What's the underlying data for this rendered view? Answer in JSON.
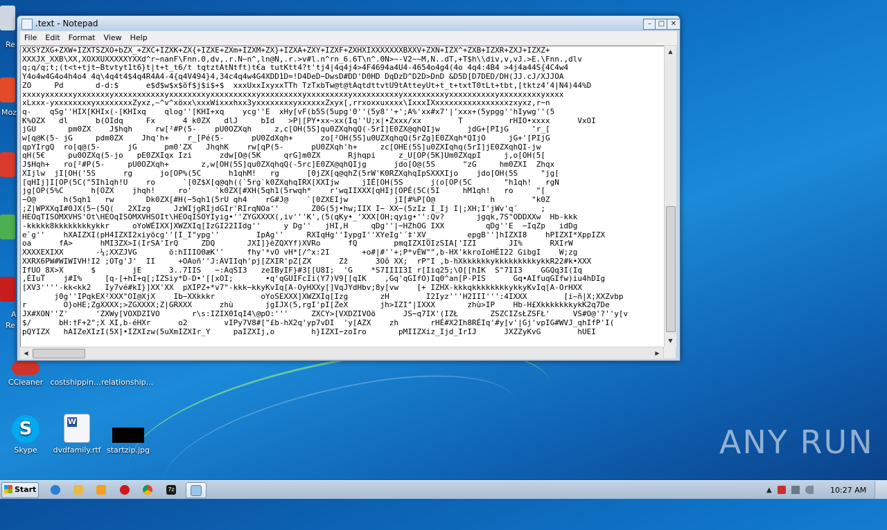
{
  "desktop": {
    "icons": [
      {
        "label": "CCleaner",
        "color": "#d0332c"
      },
      {
        "label": "costshippin...",
        "color": "#2a6fd0"
      },
      {
        "label": "relationship...",
        "color": "#2a6fd0"
      },
      {
        "label": "Skype",
        "color": "#00a9f0"
      },
      {
        "label": "dvdfamily.rtf",
        "color": "#2a5db0"
      },
      {
        "label": "startzip.jpg",
        "color": "#000000"
      }
    ],
    "edge_labels": [
      "Re",
      "Moz",
      "A",
      "Re"
    ],
    "watermark": "ANY RUN"
  },
  "notepad": {
    "title": ".text - Notepad",
    "controls": {
      "minimize": "–",
      "maximize": "□",
      "close": "✕"
    },
    "menu": [
      "File",
      "Edit",
      "Format",
      "View",
      "Help"
    ],
    "content_lines": [
      "XXSYZXG+ZXW+IZXTSZXO+bZX_+ZXC+IZXK+ZX{+IZXE+ZXm+IZXM+ZX}+IZXA+ZXY+IZXF+ZXHXIXXXXXXXBXXV+ZXN+IZX^+ZXB+IZXR+ZXJ+IZXZ+",
      "XXXJX_XXB\\XX,XOXXUXXXXXYXXd^r−nanF\\Fnn.0,dv,.r.N~n^,ln@N,.r.>v#l.n^rn_6.6T\\n^.0N>~-V2~~M,N..dT,+T$h\\\\div,v,vJ.>E.\\Fnn.,dlv",
      "q;q/q;t;(t<t+tjt−Btvtyt1t6}t|t+t_t6/t tqtztAtNtft)t€a tutKtt4?t'tj4|4q4j4>4F4694a4U4-4654o4g4(4o 4q4:4B4 >4j4a44S{4C4w4",
      "Y4o4w4G4o4h4o4 4q\\4q4t4$4q4R4A4-4{q4V494}4,34c4q4w4G4XDD1D=!D4DeD−DwsD#DD'D0HD DqDzD^D2D>DnD &D5D[D7DED/DH(JJ.cJ/XJJOA",
      "ZO     Pd       d-d:$      e$đ$w$x$öf$j$i$+$  xxxUxxIxyxxTTh TzTxbTw@t@tAqtdttvtU9tAtteyUt+t_t+txtT0tLt+tbt,[tktz4'4|N4)44%D",
      "xxxxyxxxxxxyxxxxxxxyxxxxxxxxxxxyxxxxxxxxyxxxxxxxxxxyxxxxxxxxxyxxxxxxxxxyxxxxxxxxxxyxxxxxxxxxyxxxxxxxxxxyxxxxxxxxxyxxxx",
      "xLxxx-yxxxxxxxxyxxxxxxxxZyxz,~^v^xöxx\\xxxWixxxhxx3yxxxxxxxxyxxxxxxZxyx[,rrxoxxuxxxx\\IxxxIXxxxxxxxxxxxxxxxxzxyxz,r−n",
      "q-    qSg''HIX[KHIx(-[KHIxq    qlog''[KHI+xq    ycg''E  xHy[vF(b5S(5upg'0''(5y8''+';A%'xx#x7'|'xxx+(5ypgg''hIywg''(5",
      "K%OZX   dl      b(OIdq     Fx      4 k0ZX   dlJ     bId   >P|[PY•xx~xx(Iq''U;x|•Zxxx/xx        T          rHIO•xxxx      VxOI",
      "jGU       pm0ZX    J$hqh     rw[²#P(5-    pU0OZXqh     z,c[OH(5S]qu0ZXqhqQ(-5rI]E0ZX@qhQIjw      jdG+[PIjG     'r_[",
      "w[q@K(5- jG     pdm0ZX    Jhq'h+    r_[Pé(5-      pU0ZdXqh+      zo[²OH(5S]u0UZXqhqQ(5rZg]E0ZXqh*QIjO     jG+'[PIjG",
      "qpYIrgQ  ro[q@(5-      jG      pm0'ZX   JhqhK    rw[qP(5-      pU0ZXqh'h+     zc[OHE(5S]u0ZXIqhq(5rI]jE0ZXqhQI-jw",
      "qH(5€     pu0OZXq(5-jo   pE0ZXIqx Izi      zdw[O@(5K     qrG]m0ZX      Rjhqpi     z_U[OP(5K]Um0ZXqpI     j,o[OH(5[",
      "J$Hqh+   ro[²#P(5-     pU0OZXqh+       z,w[OH(5S]qu0ZXqhqQ(-5rc]E0ZX@qhQIjg      jdo[O@(5S      \"zG     hm0ZXI  Zhqx",
      "XIjlw  jI[OH('5S      rg      jo[OP%(5C      h1qhM!   rg      [0jZX[q@qhZ(5rW'K0RZXqhqIpSXXXIjo    jdo[OH(5S     \"jg[",
      "[qHIj]I[OP(5C(\"5Ih1qh!U    ro      `[0Z$X[q@qh((`5rg`k0ZXqhqIRX[XXIjw     jIÉ[OH(5S      j(o[OP(5C       \"h1qh!   rgN",
      "jg[OP(5%C      h[OZX    jhqh!     ro'     `k0ZX[#XH(5qh1(5rwqh*    r'wqIIXXX[qHIj[OPÉ(5C(5I     hM1qh!   ro     \"[",
      "−O@      h(5qh1   rw       Dk0ZX[#H(−5qh1(5rU qh4    rG#J@    `[0ZXEIjw          jI[#%P[O@            h        \"k0Z",
      ";Z|WPXXqI#0JX(5−(5Q(   2XIzg     JzWIjgRIjdGIr'RIrqNOa''       Z0G(5j•hw;IIX I− XX−(5zIz I_Ij I|;XH;I'jWv'q´     ;",
      "HEOqTISOMXVHS'Ot\\HEOqISOMXVHSOIt\\HEOqISOYIyig•''ZYGXXXX(,iv'''K',(5(qKy•_'XXX[OH;qyig•'':Qv?       jgqk,7S\"ODDXXw  Hb-kkk",
      "-kkkkk8kkkkkkkkykkr     oYoWÉIXX]XWZXIq[IzGI22IIdg''     y Dg''   jHI,H     qDg''|−HZhOG IXX         qDg''E  −IqZp   idDg",
      "e`g''    hXAIZXI(pH4IZXI2xiyöcg''[I_I\"ypg''        IpAg''     RXIqHg''IypgI''XYeIg'´‡'XV_        epgB'']hIZXI8    hPIZXI*XppIZX",
      "oa      fA>      hMI3ZX>I(IrSA'IrQ     ZDQ       JXI]}èZQXYf)XVRo      fQ        pmqIZXIOIzSIA['IZI       JI%      RXIrW",
      "XXXXEXIXX       -¼;XXZJVG       ö:hIIIO0æK''     fhy'*vO vH*[/^x:2I       +o#|#''+;P*vÉW\"\",b-HX'kkroIoHÉI22 GibgI    W;zg",
      "XXRX6PW#WIWIVH!I2 ;OTg'J'  II     +OAoñ''J:AVIIqh'pj[ZXIR'pZ[ZX      Zž      3Oô XX;  rP\"I ,b-hXkkkkkkykkkkkkkkkykkR22#k•XXX",
      "IfUO_8X>X      $        jE      3..7IIS   −:AqSI3   zeIByIF}#3[[U8I;  'G    *S7IIII3I r[Iiq25;\\O[[hIK  S\"7II3    GGQq3I(Iq",
      ",ÉIuT    j#I%     [q-[+hI+q[;IZSiy*D-D•'[[xOI;       •q'qGUIFcIi(Y7)V9[[qIK    ,Gq'qGIfO)Iq0^an[P-PIS      Gq•AIfuqGIfw)iu4hDIg",
      "[XV3''''-kk<kk2   Iy7vé#kI}]XX'XX  pXIPZ+*v7\"-kkk−kkyKvIq[A-OyHXXy[]VqJYdHbv;8y[vw    [+ IZHX-kkkqkkkkkkkkykkyKvIq[A-OrHXX",
      "       j0g''IPqkEX²XXX\"OI@XjX    Ib−XXkkkr          oYoSEXXX]XWZXIq[Izg       zH        I2Iyz'''H2III''':4IXXX        [i~ñ|X;XXZvbp",
      "r        O}oHE;ZgXXXX;>ZGXXXX;Z|GRXXX      zhù       jgIJX(5,rgI'pI[ZeX       jh>IZI\"|IXXX       zhù>IP    Hb-H£XkkkkkkkykK2q7De",
      "JX#XON''Z'      'ZXWy[VOXDZIVO       r\\s:IZIX0IqI4\\@pO:'''     ZXCY>[VXDZIVOö      JS−q7IX'(IZŁ       ZSZCIZsŁZSFŁ'     VS#O@'?''y[v",
      "$/      bH:†F+2\";X XI,b-éHXr      o2        vIPy7V8#[\"£b-hX2q'yp7vDI  'y[AZX    zh       rHÉ#X2Ih8RÉIq'#y[v'|Gj'vpIG#WVJ_qhIfP'I(",
      "pQYIZX   hAIZeXIzI(5X]•IZXIzw(5uXmIZXIr_Y     paIZXIj,o        h}IZXI−zoIro       pMIIZXiz_Ijd_IrIJ      JXZZyKvG        hUEI"
    ]
  },
  "taskbar": {
    "start_label": "Start",
    "pinned": [
      {
        "name": "ie-icon",
        "color": "#2a7fd4"
      },
      {
        "name": "explorer-icon",
        "color": "#e8b84a"
      },
      {
        "name": "media-player-icon",
        "color": "#f0a020"
      },
      {
        "name": "opera-icon",
        "color": "#d01818"
      },
      {
        "name": "chrome-icon",
        "color": "#3aa346"
      },
      {
        "name": "7zip-icon",
        "color": "#1a1a1a"
      },
      {
        "name": "notepad-icon",
        "color": "#9cc3e8"
      }
    ],
    "time": "10:27 AM"
  }
}
